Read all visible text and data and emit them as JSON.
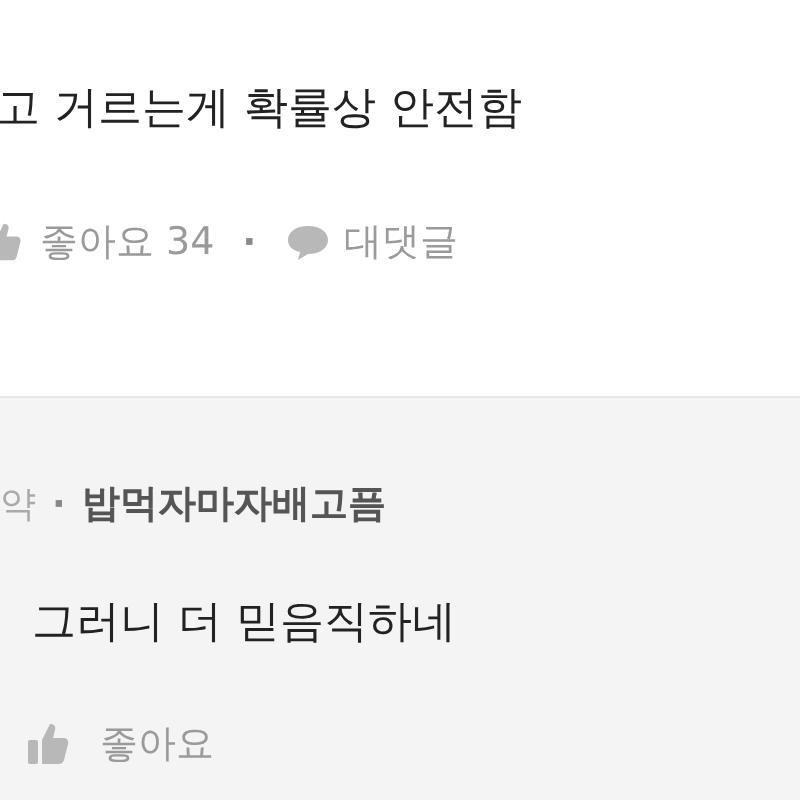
{
  "comment": {
    "text": "고 거르는게 확률상 안전함",
    "like": "좋아요 34",
    "separator": "·",
    "reply_link": "대댓글"
  },
  "reply": {
    "author_prefix": "약",
    "separator": "·",
    "author": "밥먹자마자배고픔",
    "text": "그러니 더 믿음직하네",
    "like": "좋아요"
  }
}
